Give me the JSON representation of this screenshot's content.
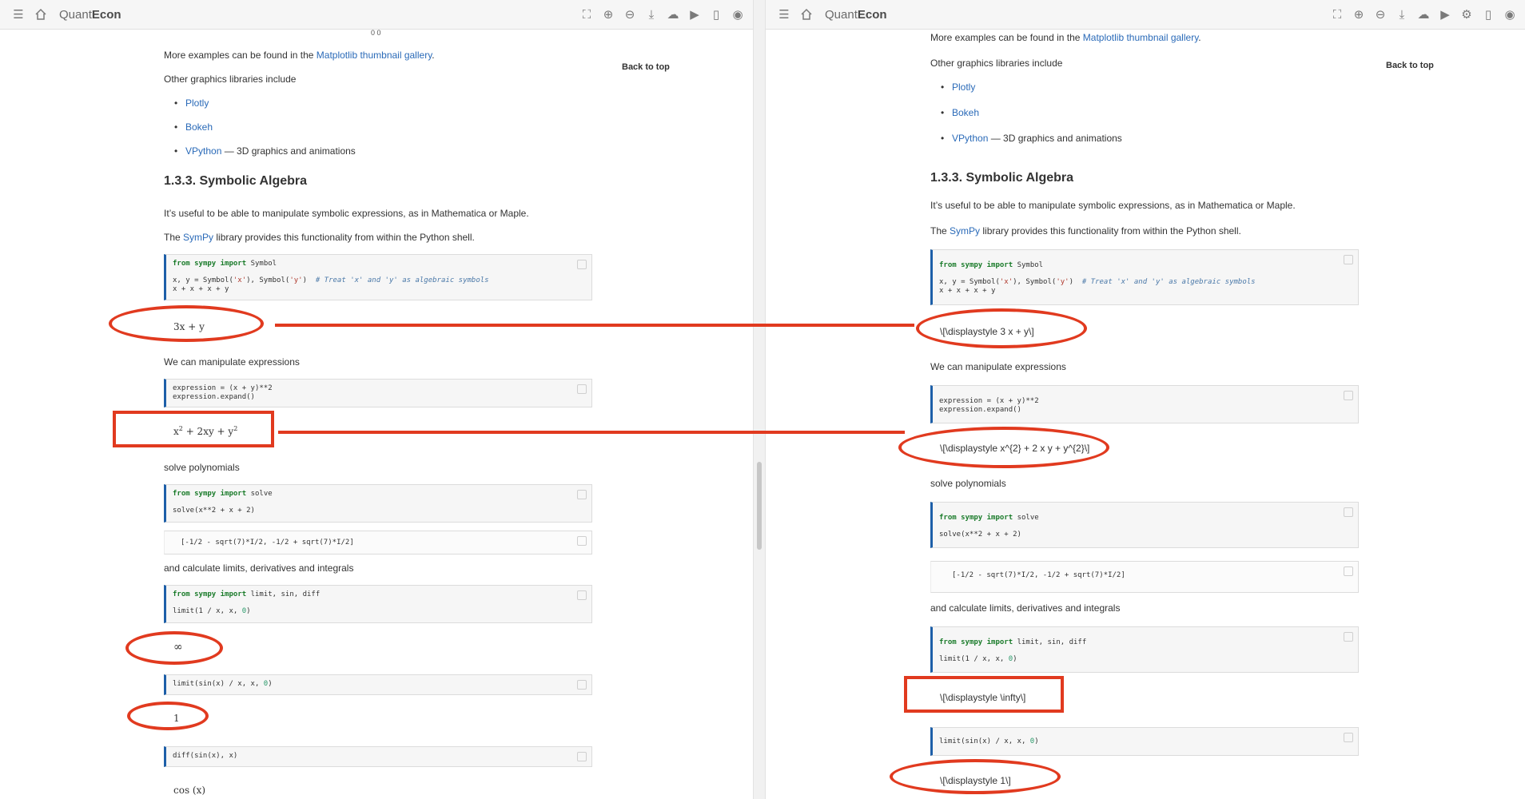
{
  "brand": {
    "prefix": "Quant",
    "suffix": "Econ"
  },
  "back_to_top": "Back to top",
  "top_markers": "0 0",
  "text": {
    "more_examples_pre": "More examples can be found in the ",
    "more_examples_link": "Matplotlib thumbnail gallery",
    "more_examples_post": ".",
    "other_libs": "Other graphics libraries include",
    "lib_plotly": "Plotly",
    "lib_bokeh": "Bokeh",
    "lib_vpython": "VPython",
    "lib_vpython_desc": " — 3D graphics and animations",
    "section_title": "1.3.3. Symbolic Algebra",
    "useful": "It’s useful to be able to manipulate symbolic expressions, as in Mathematica or Maple.",
    "sympy_pre": "The ",
    "sympy_link": "SymPy",
    "sympy_post": " library provides this functionality from within the Python shell.",
    "manipulate": "We can manipulate expressions",
    "solve_poly": "solve polynomials",
    "calc": "and calculate limits, derivatives and integrals"
  },
  "code": {
    "c1_l1_kw1": "from",
    "c1_l1_mod": "sympy",
    "c1_l1_kw2": "import",
    "c1_l1_rest": "Symbol",
    "c1_l2_pre": "x, y = Symbol(",
    "c1_l2_s1": "'x'",
    "c1_l2_mid": "), Symbol(",
    "c1_l2_s2": "'y'",
    "c1_l2_post": ")  ",
    "c1_l2_cm": "# Treat 'x' and 'y' as algebraic symbols",
    "c1_l3": "x + x + x + y",
    "c2_l1": "expression = (x + y)**2",
    "c2_l2": "expression.expand()",
    "c3_l1_kw1": "from",
    "c3_l1_mod": "sympy",
    "c3_l1_kw2": "import",
    "c3_l1_rest": "solve",
    "c3_l2": "solve(x**2 + x + 2)",
    "out3": "[-1/2 - sqrt(7)*I/2, -1/2 + sqrt(7)*I/2]",
    "c4_l1_kw1": "from",
    "c4_l1_mod": "sympy",
    "c4_l1_kw2": "import",
    "c4_l1_rest": "limit, sin, diff",
    "c4_l2_pre": "limit(1 / x, x, ",
    "c4_l2_num": "0",
    "c4_l2_post": ")",
    "c5_pre": "limit(sin(x) / x, x, ",
    "c5_num": "0",
    "c5_post": ")",
    "c6": "diff(sin(x), x)"
  },
  "math_left": {
    "m1": "3x + y",
    "m2_a": "x",
    "m2_b": "2",
    "m2_c": " + 2xy + y",
    "m2_d": "2",
    "m3": "∞",
    "m4": "1",
    "m5": "cos (x)"
  },
  "math_right": {
    "m1": "\\[\\displaystyle 3 x + y\\]",
    "m2": "\\[\\displaystyle x^{2} + 2 x y + y^{2}\\]",
    "m3": "\\[\\displaystyle \\infty\\]",
    "m4": "\\[\\displaystyle 1\\]"
  },
  "annotation_color": "#e13a1f",
  "link_color": "#2a6ab8",
  "code_border_color": "#1d5fa8"
}
